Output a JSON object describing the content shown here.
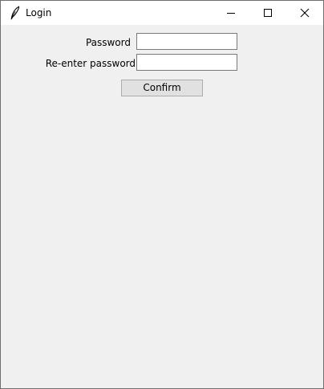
{
  "window": {
    "title": "Login",
    "icon": "feather-icon",
    "controls": {
      "minimize": "minimize-icon",
      "maximize": "maximize-icon",
      "close": "close-icon"
    }
  },
  "form": {
    "password_label": "Password",
    "password_value": "",
    "reenter_label": "Re-enter password",
    "reenter_value": "",
    "confirm_label": "Confirm"
  },
  "colors": {
    "window_background": "#f0f0f0",
    "titlebar_background": "#ffffff",
    "button_background": "#e1e1e1"
  }
}
